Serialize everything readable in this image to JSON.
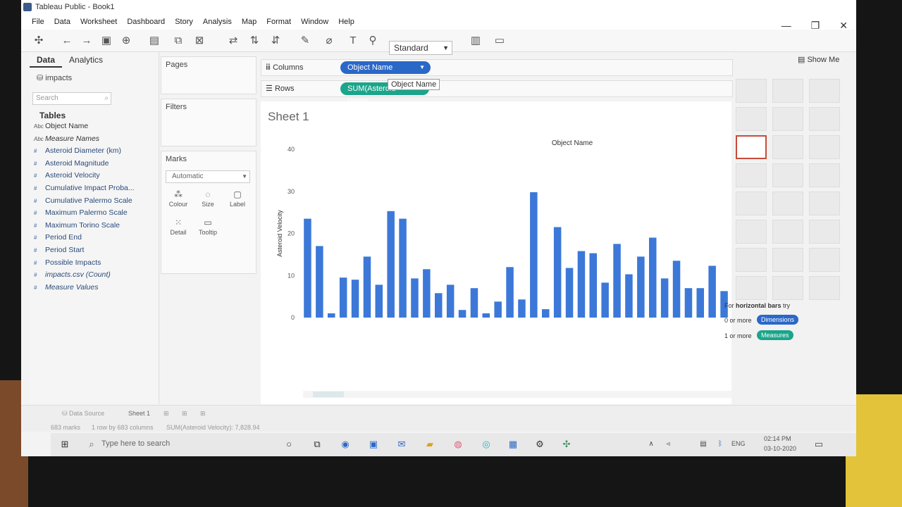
{
  "window": {
    "title": "Tableau Public - Book1"
  },
  "menu": [
    "File",
    "Data",
    "Worksheet",
    "Dashboard",
    "Story",
    "Analysis",
    "Map",
    "Format",
    "Window",
    "Help"
  ],
  "toolbar": {
    "fit_select": "Standard"
  },
  "left_pane": {
    "tabs": [
      "Data",
      "Analytics"
    ],
    "datasource": "impacts",
    "search_placeholder": "Search",
    "tables_heading": "Tables",
    "fields": [
      {
        "type": "Abc",
        "name": "Object Name",
        "kind": "dim"
      },
      {
        "type": "Abc",
        "name": "Measure Names",
        "kind": "dim-it"
      },
      {
        "type": "#",
        "name": "Asteroid Diameter (km)",
        "kind": "meas"
      },
      {
        "type": "#",
        "name": "Asteroid Magnitude",
        "kind": "meas"
      },
      {
        "type": "#",
        "name": "Asteroid Velocity",
        "kind": "meas"
      },
      {
        "type": "#",
        "name": "Cumulative Impact Proba...",
        "kind": "meas"
      },
      {
        "type": "#",
        "name": "Cumulative Palermo Scale",
        "kind": "meas"
      },
      {
        "type": "#",
        "name": "Maximum Palermo Scale",
        "kind": "meas"
      },
      {
        "type": "#",
        "name": "Maximum Torino Scale",
        "kind": "meas"
      },
      {
        "type": "#",
        "name": "Period End",
        "kind": "meas"
      },
      {
        "type": "#",
        "name": "Period Start",
        "kind": "meas"
      },
      {
        "type": "#",
        "name": "Possible Impacts",
        "kind": "meas"
      },
      {
        "type": "#",
        "name": "impacts.csv (Count)",
        "kind": "meas-it"
      },
      {
        "type": "#",
        "name": "Measure Values",
        "kind": "meas-it"
      }
    ]
  },
  "cards": {
    "pages": "Pages",
    "filters": "Filters",
    "marks": "Marks",
    "mark_type": "Automatic",
    "mark_buttons": [
      "Colour",
      "Size",
      "Label",
      "Detail",
      "Tooltip"
    ]
  },
  "shelves": {
    "columns_label": "Columns",
    "rows_label": "Rows",
    "columns_pill": "Object Name",
    "rows_pill": "SUM(Asteroid Veloci..",
    "tooltip": "Object Name"
  },
  "sheet_title": "Sheet 1",
  "show_me": {
    "header": "Show Me",
    "hint_prefix": "For",
    "hint_bold": "horizontal bars",
    "hint_suffix": "try",
    "dims_text": "0 or more",
    "dims_pill": "Dimensions",
    "meas_text": "1 or more",
    "meas_pill": "Measures"
  },
  "bottom": {
    "datasource_tab": "Data Source",
    "sheet_tab": "Sheet 1",
    "status_marks": "683 marks",
    "status_rows": "1 row by 683 columns",
    "status_sum": "SUM(Asteroid Velocity): 7,828.94"
  },
  "taskbar": {
    "search": "Type here to search",
    "lang": "ENG",
    "time": "02:14 PM",
    "date": "03-10-2020"
  },
  "colors": {
    "bar": "#3b78d8",
    "pill_dim": "#2a68c8",
    "pill_meas": "#1ba58a"
  },
  "chart_data": {
    "type": "bar",
    "xlabel": "Object Name",
    "ylabel": "Asteroid Velocity",
    "ylim": [
      0,
      40
    ],
    "yticks": [
      0,
      10,
      20,
      30,
      40
    ],
    "values": [
      23.5,
      17,
      1,
      9.5,
      9,
      14.5,
      7.8,
      25.3,
      23.5,
      9.3,
      11.5,
      5.8,
      7.8,
      1.8,
      7,
      1,
      3.8,
      12,
      4.3,
      29.8,
      2,
      21.5,
      11.8,
      15.8,
      15.3,
      8.3,
      17.5,
      10.3,
      14.5,
      19,
      9.3,
      13.5,
      7,
      7,
      12.3,
      6.3
    ]
  }
}
